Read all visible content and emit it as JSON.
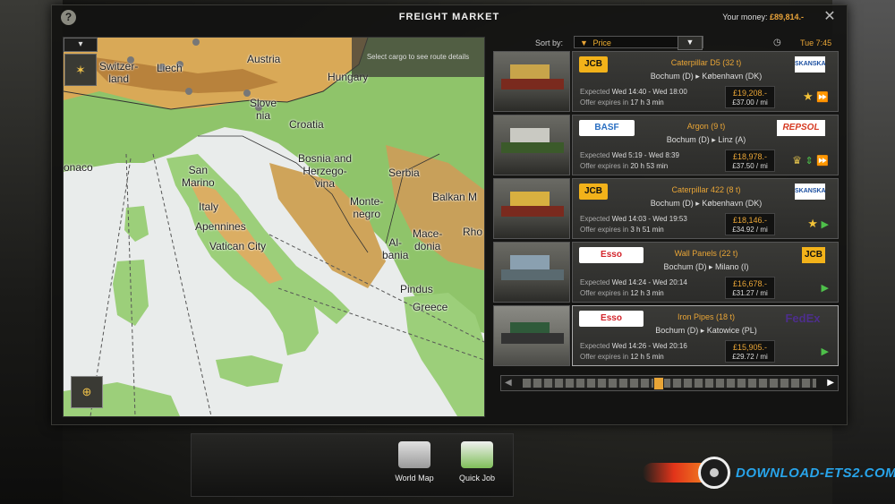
{
  "window": {
    "title": "FREIGHT MARKET",
    "money_label": "Your money:",
    "money_value": "£89,814.-"
  },
  "map": {
    "hint": "Select cargo to see route details",
    "labels": [
      {
        "text": "Switzer-\nland",
        "cls": "l1"
      },
      {
        "text": "Liech",
        "cls": "l2"
      },
      {
        "text": "Austria",
        "cls": "l3"
      },
      {
        "text": "Hungary",
        "cls": "l4"
      },
      {
        "text": "Slove\nnia",
        "cls": "l5"
      },
      {
        "text": "Croatia",
        "cls": "l6"
      },
      {
        "text": "Bosnia and\nHerzego-\nvina",
        "cls": "l7"
      },
      {
        "text": "Serbia",
        "cls": "l8"
      },
      {
        "text": "Monte-\nnegro",
        "cls": "l9"
      },
      {
        "text": "Balkan M",
        "cls": "l10"
      },
      {
        "text": "Rho",
        "cls": "l11"
      },
      {
        "text": "San\nMarino",
        "cls": "l12"
      },
      {
        "text": "Italy",
        "cls": "l13"
      },
      {
        "text": "Apennines",
        "cls": "l14"
      },
      {
        "text": "Vatican City",
        "cls": "l15"
      },
      {
        "text": "Al-\nbania",
        "cls": "l16"
      },
      {
        "text": "Mace-\ndonia",
        "cls": "l17"
      },
      {
        "text": "Pindus",
        "cls": "l18"
      },
      {
        "text": "Greece",
        "cls": "l19"
      },
      {
        "text": "onaco",
        "cls": "l20"
      }
    ]
  },
  "sort": {
    "label": "Sort by:",
    "value": "Price",
    "time": "Tue 7:45"
  },
  "offers": [
    {
      "left_logo": "JCB",
      "left_logo_color": "#f2b21a",
      "cargo": "Caterpillar D5 (32 t)",
      "route": "Bochum (D) ▸ København (DK)",
      "right_logo": "SKANSKA",
      "right_logo_color": "#1b4fa0",
      "expected_label": "Expected",
      "expected": "Wed 14:40 - Wed 18:00",
      "expires_label": "Offer expires in",
      "expires": "17 h 3 min",
      "price": "£19,208.-",
      "per_mile": "£37.00 / mi",
      "icons": [
        "star-icon",
        "fast-forward-icon"
      ]
    },
    {
      "left_logo": "BASF",
      "left_logo_color": "#2a6fc2",
      "cargo": "Argon (9 t)",
      "route": "Bochum (D) ▸ Linz (A)",
      "right_logo": "REPSOL",
      "right_logo_color": "#d63a22",
      "expected_label": "Expected",
      "expected": "Wed 5:19 - Wed 8:39",
      "expires_label": "Offer expires in",
      "expires": "20 h 53 min",
      "price": "£18,978.-",
      "per_mile": "£37.50 / mi",
      "icons": [
        "trophy-icon",
        "up-down-icon",
        "fast-forward-icon"
      ]
    },
    {
      "left_logo": "JCB",
      "left_logo_color": "#f2b21a",
      "cargo": "Caterpillar 422 (8 t)",
      "route": "Bochum (D) ▸ København (DK)",
      "right_logo": "SKANSKA",
      "right_logo_color": "#1b4fa0",
      "expected_label": "Expected",
      "expected": "Wed 14:03 - Wed 19:53",
      "expires_label": "Offer expires in",
      "expires": "3 h 51 min",
      "price": "£18,146.-",
      "per_mile": "£34.92 / mi",
      "icons": [
        "star-icon",
        "play-icon"
      ]
    },
    {
      "left_logo": "Esso",
      "left_logo_color": "#d3232a",
      "cargo": "Wall Panels (22 t)",
      "route": "Bochum (D) ▸ Milano (I)",
      "right_logo": "JCB",
      "right_logo_color": "#f2b21a",
      "expected_label": "Expected",
      "expected": "Wed 14:24 - Wed 20:14",
      "expires_label": "Offer expires in",
      "expires": "12 h 3 min",
      "price": "£16,678.-",
      "per_mile": "£31.27 / mi",
      "icons": [
        "play-icon"
      ]
    },
    {
      "left_logo": "Esso",
      "left_logo_color": "#d3232a",
      "cargo": "Iron Pipes (18 t)",
      "route": "Bochum (D) ▸ Katowice (PL)",
      "right_logo": "FedEx",
      "right_logo_color": "#4d2e8c",
      "expected_label": "Expected",
      "expected": "Wed 14:26 - Wed 20:16",
      "expires_label": "Offer expires in",
      "expires": "12 h 5 min",
      "price": "£15,905.-",
      "per_mile": "£29.72 / mi",
      "icons": [
        "play-icon"
      ]
    }
  ],
  "bottom": {
    "world_map": "World Map",
    "quick_job": "Quick Job"
  },
  "watermark": "DOWNLOAD-ETS2.COM"
}
